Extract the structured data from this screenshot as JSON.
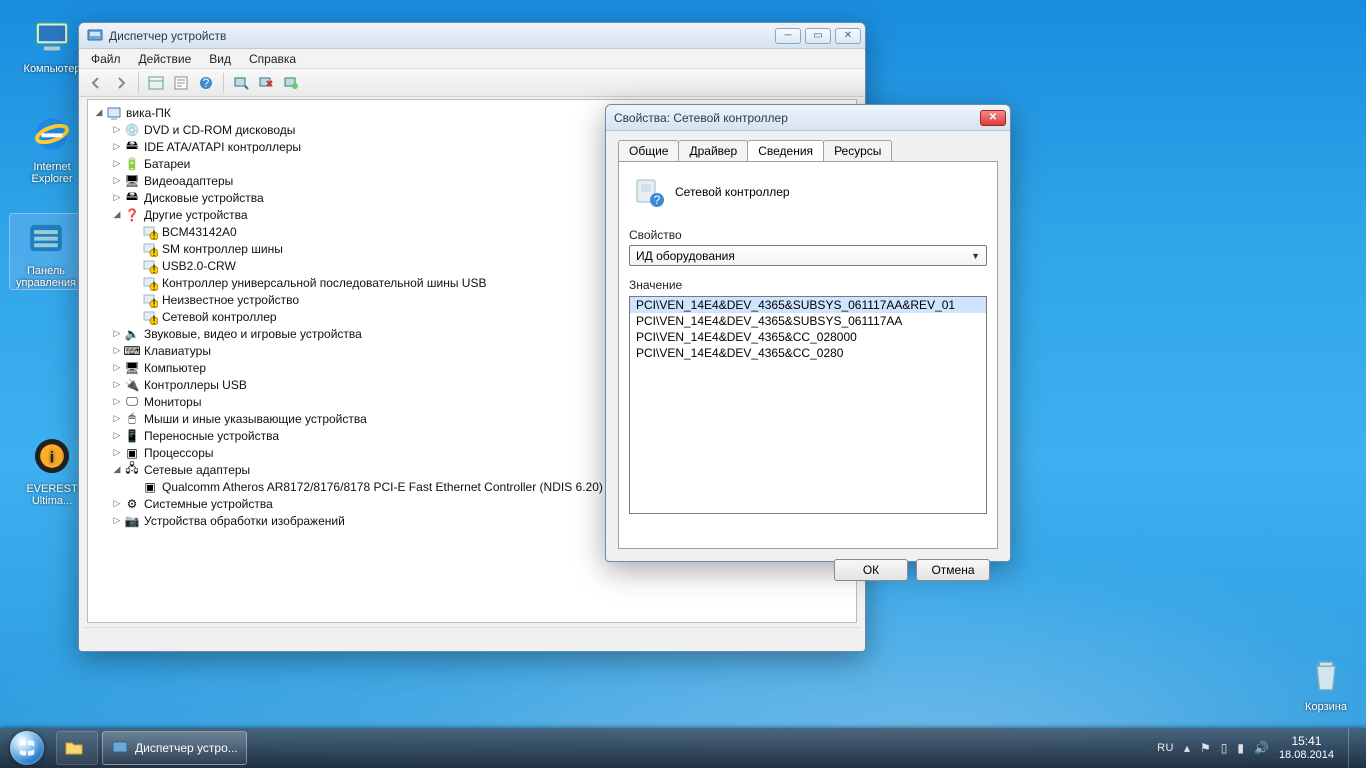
{
  "desktop": {
    "icons": [
      {
        "id": "computer",
        "label": "Компьютер"
      },
      {
        "id": "ie",
        "label": "Internet Explorer"
      },
      {
        "id": "ctrlpanel",
        "label": "Панель управления"
      },
      {
        "id": "everest",
        "label": "EVEREST Ultima..."
      },
      {
        "id": "recycle",
        "label": "Корзина"
      }
    ]
  },
  "devmgr": {
    "title": "Диспетчер устройств",
    "menu": [
      "Файл",
      "Действие",
      "Вид",
      "Справка"
    ],
    "tree": {
      "root": "вика-ПК",
      "cats": [
        {
          "label": "DVD и CD-ROM дисководы",
          "icon": "cd"
        },
        {
          "label": "IDE ATA/ATAPI контроллеры",
          "icon": "ide"
        },
        {
          "label": "Батареи",
          "icon": "bat"
        },
        {
          "label": "Видеоадаптеры",
          "icon": "vga"
        },
        {
          "label": "Дисковые устройства",
          "icon": "hdd"
        },
        {
          "label": "Другие устройства",
          "icon": "unk",
          "expanded": true,
          "children": [
            {
              "label": "BCM43142A0",
              "warn": true
            },
            {
              "label": "SM контроллер шины",
              "warn": true
            },
            {
              "label": "USB2.0-CRW",
              "warn": true
            },
            {
              "label": "Контроллер универсальной последовательной шины USB",
              "warn": true
            },
            {
              "label": "Неизвестное устройство",
              "warn": true
            },
            {
              "label": "Сетевой контроллер",
              "warn": true
            }
          ]
        },
        {
          "label": "Звуковые, видео и игровые устройства",
          "icon": "snd"
        },
        {
          "label": "Клавиатуры",
          "icon": "kbd"
        },
        {
          "label": "Компьютер",
          "icon": "pc"
        },
        {
          "label": "Контроллеры USB",
          "icon": "usb"
        },
        {
          "label": "Мониторы",
          "icon": "mon"
        },
        {
          "label": "Мыши и иные указывающие устройства",
          "icon": "mouse"
        },
        {
          "label": "Переносные устройства",
          "icon": "port"
        },
        {
          "label": "Процессоры",
          "icon": "cpu"
        },
        {
          "label": "Сетевые адаптеры",
          "icon": "net",
          "expanded": true,
          "children": [
            {
              "label": "Qualcomm Atheros AR8172/8176/8178 PCI-E Fast Ethernet Controller (NDIS 6.20)",
              "warn": false
            }
          ]
        },
        {
          "label": "Системные устройства",
          "icon": "sys"
        },
        {
          "label": "Устройства обработки изображений",
          "icon": "img"
        }
      ]
    }
  },
  "props": {
    "title": "Свойства: Сетевой контроллер",
    "tabs": [
      "Общие",
      "Драйвер",
      "Сведения",
      "Ресурсы"
    ],
    "active_tab": 2,
    "device_name": "Сетевой контроллер",
    "prop_label": "Свойство",
    "prop_value": "ИД оборудования",
    "value_label": "Значение",
    "values": [
      "PCI\\VEN_14E4&DEV_4365&SUBSYS_061117AA&REV_01",
      "PCI\\VEN_14E4&DEV_4365&SUBSYS_061117AA",
      "PCI\\VEN_14E4&DEV_4365&CC_028000",
      "PCI\\VEN_14E4&DEV_4365&CC_0280"
    ],
    "ok": "ОК",
    "cancel": "Отмена"
  },
  "taskbar": {
    "app_label": "Диспетчер устро...",
    "lang": "RU",
    "time": "15:41",
    "date": "18.08.2014"
  }
}
